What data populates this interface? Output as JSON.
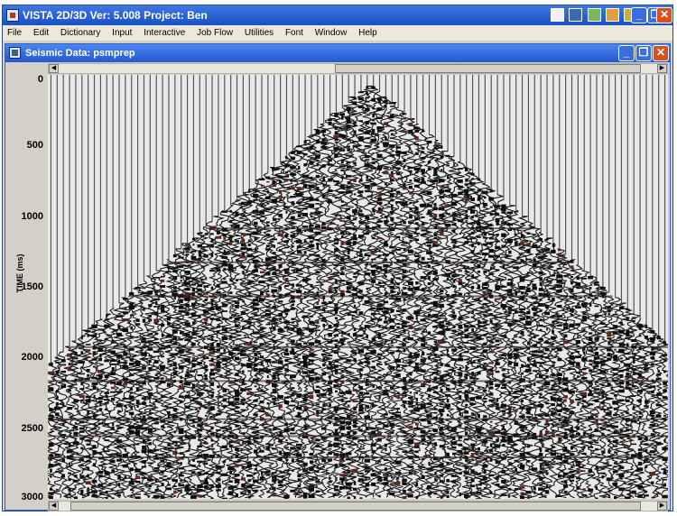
{
  "app": {
    "title": "VISTA 2D/3D Ver: 5.008 Project: Ben",
    "toolbar_icons": [
      "grid-icon",
      "save-icon",
      "chart-icon",
      "image-icon",
      "settings-icon"
    ],
    "window_controls": {
      "minimize": "_",
      "restore": "❐",
      "close": "✕"
    }
  },
  "menu": {
    "items": [
      "File",
      "Edit",
      "Dictionary",
      "Input",
      "Interactive",
      "Job Flow",
      "Utilities",
      "Font",
      "Window",
      "Help"
    ]
  },
  "child_window": {
    "title": "Seismic Data: psmprep",
    "window_controls": {
      "minimize": "_",
      "restore": "❐",
      "close": "✕"
    }
  },
  "seismic": {
    "y_axis_label": "TIME (ms)",
    "ticks": [
      "0",
      "500",
      "1000",
      "1500",
      "2000",
      "2500",
      "3000"
    ],
    "tick_values": [
      0,
      500,
      1000,
      1500,
      2000,
      2500,
      3000
    ],
    "time_range_ms": [
      0,
      3000
    ],
    "apex_time_ms": 60,
    "edge_time_ms": 1980
  },
  "scrollbars": {
    "top": {
      "thumb_start": 0.46,
      "thumb_end": 0.97
    },
    "bottom": {
      "thumb_start": 0.02,
      "thumb_end": 0.97
    }
  }
}
